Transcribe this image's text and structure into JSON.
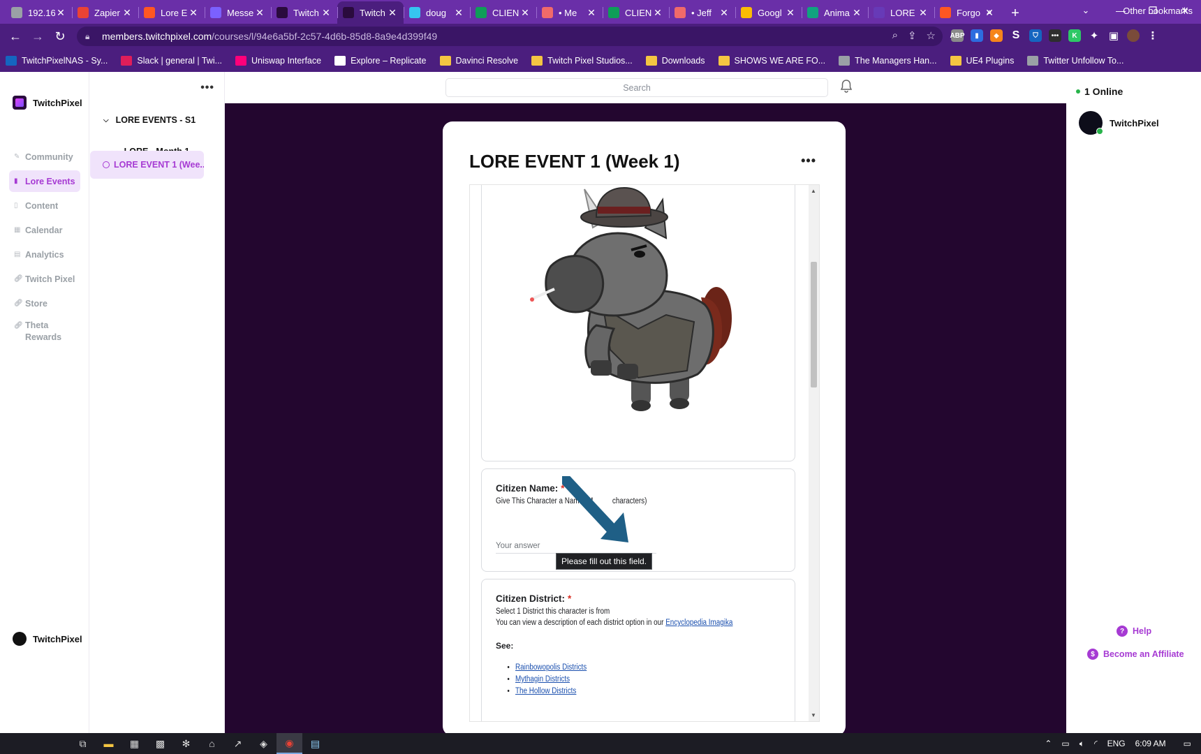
{
  "browser": {
    "tabs": [
      {
        "label": "192.16",
        "color": "#9aa0a6"
      },
      {
        "label": "Zapier",
        "color": "#ea4335"
      },
      {
        "label": "Lore E",
        "color": "#ff5722"
      },
      {
        "label": "Messe",
        "color": "#7b61ff"
      },
      {
        "label": "Twitch",
        "color": "#2a0b3d"
      },
      {
        "label": "Twitch",
        "color": "#2a0b3d"
      },
      {
        "label": "doug",
        "color": "#36c5f0"
      },
      {
        "label": "CLIEN",
        "color": "#0f9d58"
      },
      {
        "label": "• Me",
        "color": "#f06a6a"
      },
      {
        "label": "CLIEN",
        "color": "#0f9d58"
      },
      {
        "label": "• Jeff",
        "color": "#f06a6a"
      },
      {
        "label": "Googl",
        "color": "#fbbc04"
      },
      {
        "label": "Anima",
        "color": "#10a37f"
      },
      {
        "label": "LORE",
        "color": "#673ab7"
      },
      {
        "label": "Forgo",
        "color": "#ff5722"
      }
    ],
    "active_tab_index": 5,
    "url_host": "members.twitchpixel.com",
    "url_path": "/courses/l/94e6a5bf-2c57-4d6b-85d8-8a9e4d399f49",
    "bookmarks": [
      {
        "label": "TwitchPixelNAS - Sy...",
        "color": "#1565c0"
      },
      {
        "label": "Slack | general | Twi...",
        "color": "#e01e5a"
      },
      {
        "label": "Uniswap Interface",
        "color": "#ff007a"
      },
      {
        "label": "Explore – Replicate",
        "color": "#ffffff"
      },
      {
        "label": "Davinci Resolve",
        "color": "folder"
      },
      {
        "label": "Twitch Pixel Studios...",
        "color": "folder"
      },
      {
        "label": "Downloads",
        "color": "folder"
      },
      {
        "label": "SHOWS WE ARE FO...",
        "color": "folder"
      },
      {
        "label": "The Managers Han...",
        "color": "#9aa0a6"
      },
      {
        "label": "UE4 Plugins",
        "color": "folder"
      },
      {
        "label": "Twitter Unfollow To...",
        "color": "#9aa0a6"
      }
    ],
    "bookmarks_more": "»",
    "other_bookmarks": "Other bookmarks"
  },
  "sidebar": {
    "brand": "TwitchPixel",
    "items": [
      {
        "label": "Community",
        "icon": "community-icon",
        "active": false
      },
      {
        "label": "Lore Events",
        "icon": "book-icon",
        "active": true
      },
      {
        "label": "Content",
        "icon": "document-icon",
        "active": false
      },
      {
        "label": "Calendar",
        "icon": "calendar-icon",
        "active": false
      },
      {
        "label": "Analytics",
        "icon": "analytics-icon",
        "active": false
      },
      {
        "label": "Twitch Pixel",
        "icon": "link-icon",
        "active": false
      },
      {
        "label": "Store",
        "icon": "link-icon",
        "active": false
      },
      {
        "label": "Theta Rewards",
        "icon": "link-icon",
        "active": false
      }
    ],
    "bottom_user": "TwitchPixel"
  },
  "course_nav": {
    "more": "•••",
    "section": "LORE EVENTS - S1",
    "subsection": "LORE - Month 1",
    "lesson": "LORE EVENT 1 (Wee..."
  },
  "header": {
    "search_placeholder": "Search"
  },
  "lesson": {
    "title": "LORE EVENT 1 (Week 1)",
    "more": "•••",
    "form": {
      "q1_title": "Citizen Name:",
      "q1_required": "*",
      "q1_desc": "Give This Character a Name (M",
      "q1_desc_end": "characters)",
      "q1_answer_placeholder": "Your answer",
      "validation_tooltip": "Please fill out this field.",
      "q2_title": "Citizen District:",
      "q2_required": "*",
      "q2_desc_line1": "Select 1 District this character is from",
      "q2_desc_line2": "You can view a description of each district option in our ",
      "q2_link": "Encyclopedia Imagika",
      "q2_see": "See:",
      "q2_links": [
        "Rainbowopolis Districts",
        "Mythagin Districts",
        "The Hollow Districts"
      ]
    }
  },
  "right_panel": {
    "online": "1 Online",
    "member": "TwitchPixel",
    "help": "Help",
    "affiliate": "Become an Affiliate"
  },
  "taskbar": {
    "language": "ENG",
    "time": "6:09 AM"
  },
  "colors": {
    "browser_frame": "#6a2fa8",
    "toolbar": "#4b1e7e",
    "accent": "#a63ad3",
    "stage": "#23062f"
  }
}
